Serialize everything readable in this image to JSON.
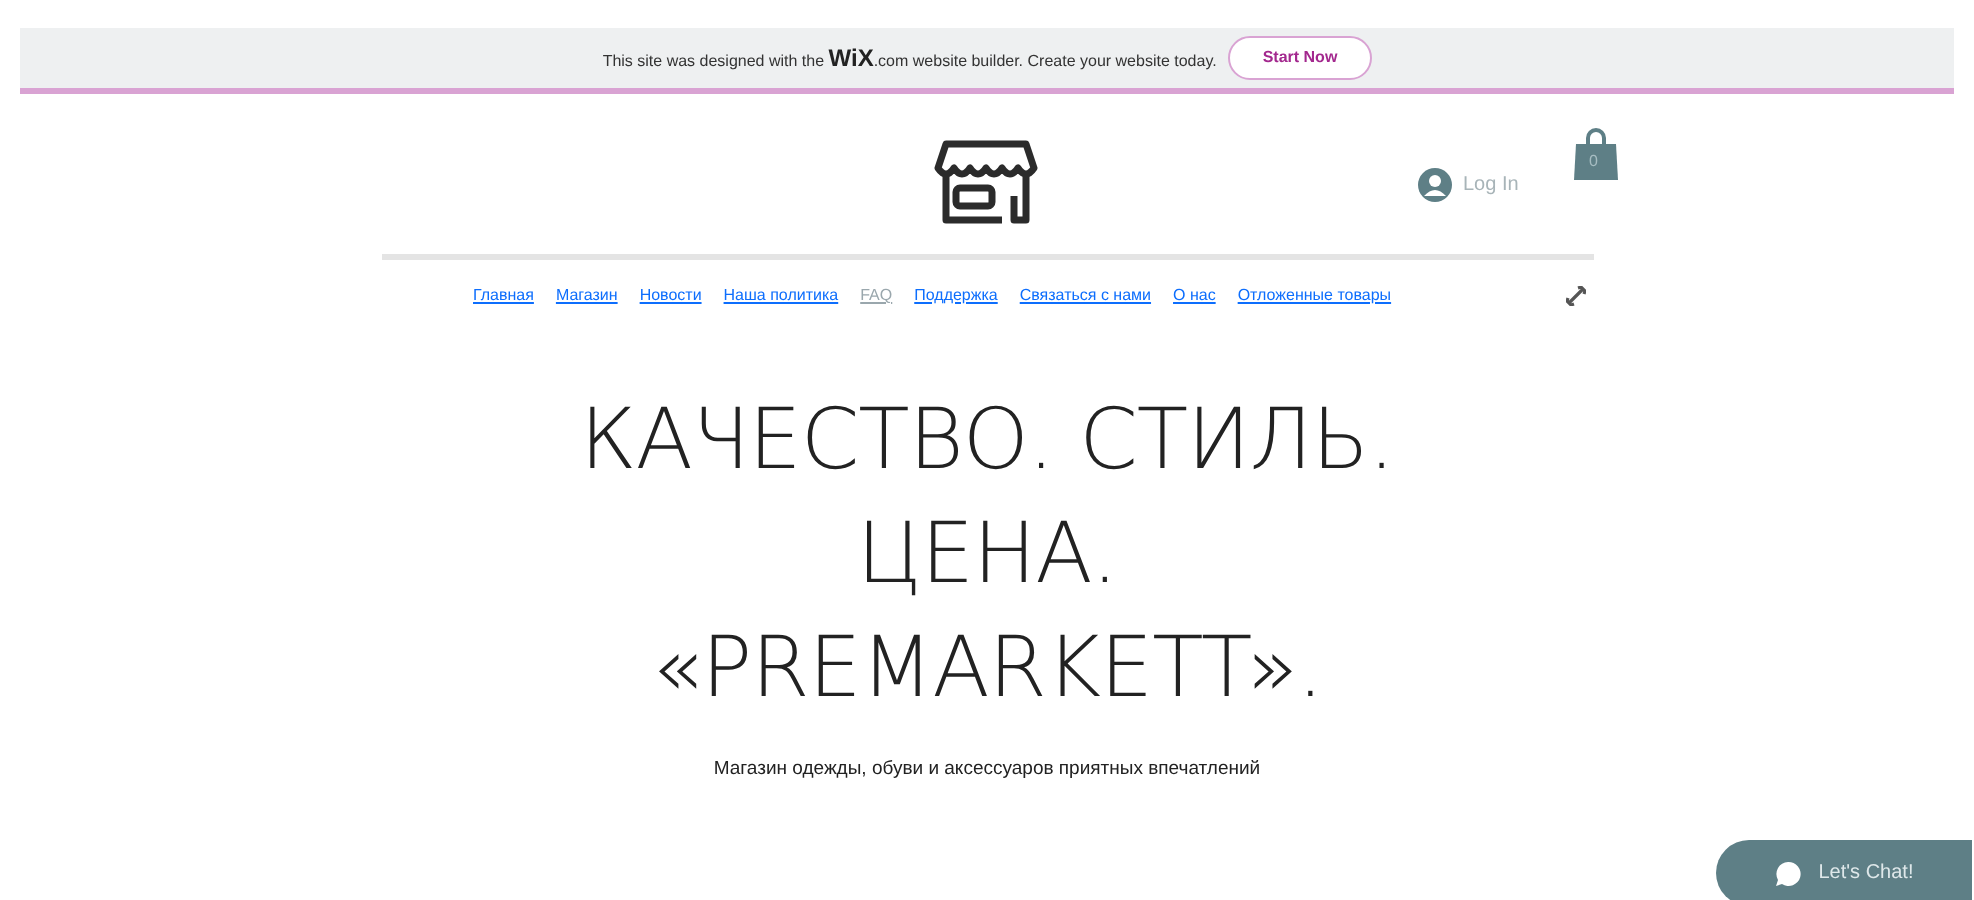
{
  "banner": {
    "text": "This site was designed with the **WiX**.com website builder. Create your website today.",
    "button": "Start Now"
  },
  "header": {
    "login": "Log In",
    "cart_count": "0"
  },
  "nav": [
    {
      "label": "Главная",
      "selected": false
    },
    {
      "label": "Магазин",
      "selected": false
    },
    {
      "label": "Новости",
      "selected": false
    },
    {
      "label": "Наша политика",
      "selected": false
    },
    {
      "label": "FAQ",
      "selected": true
    },
    {
      "label": "Поддержка",
      "selected": false
    },
    {
      "label": "Связаться с нами",
      "selected": false
    },
    {
      "label": "О нас",
      "selected": false
    },
    {
      "label": "Отложенные товары",
      "selected": false
    }
  ],
  "hero": {
    "lines": [
      "КАЧЕСТВО. СТИЛЬ.",
      "ЦЕНА.",
      "«PREMARKETT»."
    ],
    "tagline": "Магазин одежды, обуви и аксессуаров приятных впечатлений"
  },
  "chat": {
    "label": "Let's Chat!"
  }
}
